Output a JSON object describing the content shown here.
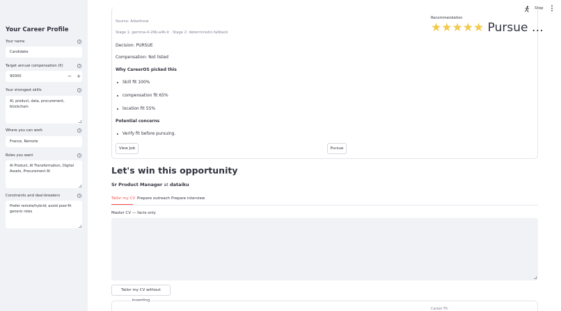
{
  "sidebar": {
    "title": "Your Career Profile",
    "name_label": "Your name",
    "name_value": "Candidate",
    "comp_label": "Target annual compensation (€)",
    "comp_value": "90000",
    "minus": "−",
    "plus": "+",
    "skills_label": "Your strongest skills",
    "skills_value": "AI, product, data, procurement, blockchain",
    "where_label": "Where you can work",
    "where_value": "France, Remote",
    "roles_label": "Roles you want",
    "roles_value": "AI Product, AI Transformation, Digital Assets, Procurement AI",
    "constraints_label": "Constraints and deal-breakers",
    "constraints_value": "Prefer remote/hybrid; avoid poor-fit generic roles",
    "help_glyph": "?"
  },
  "topbar": {
    "running_icon": "running-figure-icon",
    "stop_label": "Stop",
    "menu_icon": "kebab-menu-icon"
  },
  "job_card": {
    "source": "Source: Arbeitnow",
    "stages": "Stage 1: gemma-4-26b-a4b-it · Stage 2: deterministic-fallback",
    "decision": "Decision: PURSUE",
    "compensation": "Compensation: Not listed",
    "why_heading": "Why CareerOS picked this",
    "why_items": [
      "Skill fit 100%",
      "compensation fit 65%",
      "location fit 55%"
    ],
    "concerns_heading": "Potential concerns",
    "concerns_items": [
      "Verify fit before pursuing."
    ],
    "view_job_label": "View Job",
    "pursue_label": "Pursue",
    "rec_label": "Recommendation",
    "rec_value": "⭐⭐⭐⭐⭐ Pursue …",
    "star_color": "#f2c94c"
  },
  "main": {
    "heading": "Let's win this opportunity",
    "role_title": "Sr Product Manager",
    "role_at": "at",
    "company": "dataiku",
    "tabs": [
      "Tailor my CV",
      "Prepare outreach",
      "Prepare interview"
    ],
    "active_tab_color": "#ff4b4b",
    "cv_label": "Master CV — facts only",
    "tailor_button": "Tailor my CV without inventing",
    "next_card_label": "Career Fit"
  }
}
